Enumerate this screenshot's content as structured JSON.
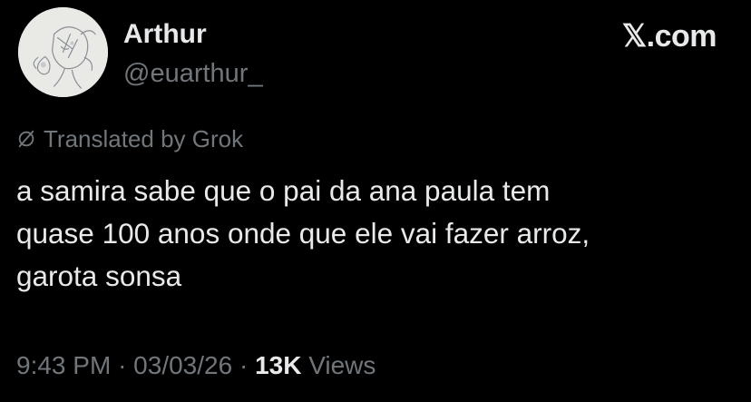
{
  "brand": {
    "label": "𝕏.com"
  },
  "author": {
    "display_name": "Arthur",
    "handle": "@euarthur_"
  },
  "translation": {
    "label": "Translated by Grok",
    "icon": "translate-slash-icon"
  },
  "tweet": {
    "lines": [
      "a samira sabe que o pai da ana paula tem",
      "quase 100 anos onde que ele vai fazer arroz,",
      "garota sonsa"
    ]
  },
  "meta": {
    "time": "9:43 PM",
    "separator": "·",
    "date": "03/03/26",
    "views_count": "13K",
    "views_label": "Views"
  },
  "colors": {
    "background": "#000000",
    "primary_text": "#e7e9ea",
    "secondary_text": "#71767b",
    "avatar_bg": "#e9e9e6"
  }
}
